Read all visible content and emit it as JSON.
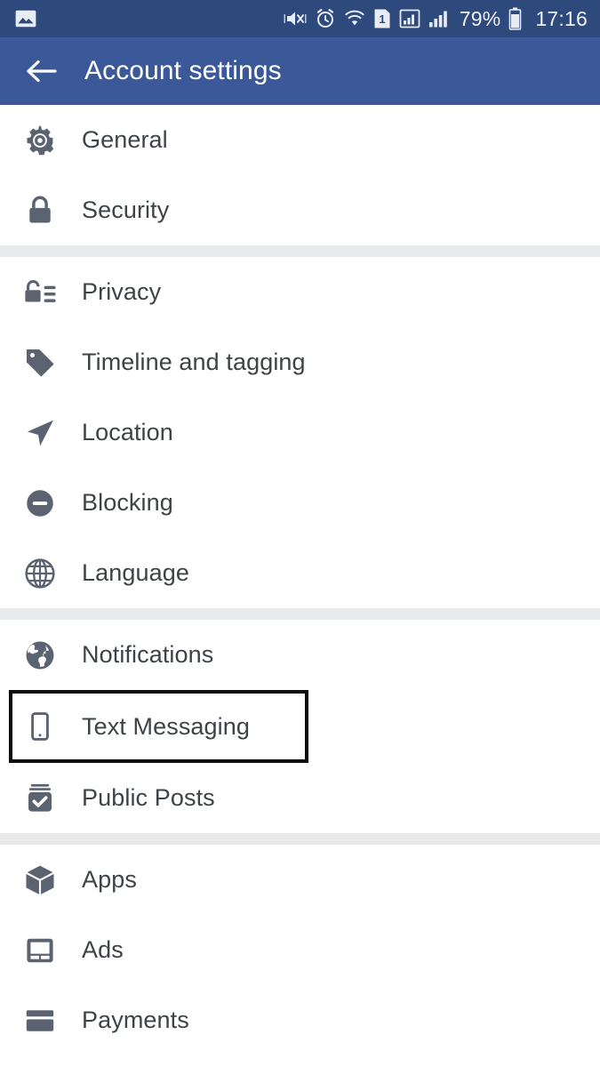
{
  "statusbar": {
    "left_icon": "image-thumbnail-icon",
    "icons": [
      "mute-vibrate-icon",
      "alarm-icon",
      "wifi-icon",
      "sim-1-icon",
      "signal-sim1-icon",
      "signal-sim2-icon"
    ],
    "battery_percent": "79%",
    "battery_icon": "battery-icon",
    "time": "17:16",
    "background_color": "#2e4a7d"
  },
  "appbar": {
    "back_icon": "back-arrow-icon",
    "title": "Account settings",
    "background_color": "#3b5998",
    "text_color": "#ffffff"
  },
  "sections": [
    {
      "items": [
        {
          "label": "General",
          "icon": "gear-icon"
        },
        {
          "label": "Security",
          "icon": "lock-icon"
        }
      ]
    },
    {
      "items": [
        {
          "label": "Privacy",
          "icon": "privacy-lock-list-icon"
        },
        {
          "label": "Timeline and tagging",
          "icon": "tag-icon"
        },
        {
          "label": "Location",
          "icon": "navigation-arrow-icon"
        },
        {
          "label": "Blocking",
          "icon": "minus-circle-icon"
        },
        {
          "label": "Language",
          "icon": "globe-outline-icon"
        }
      ]
    },
    {
      "items": [
        {
          "label": "Notifications",
          "icon": "globe-filled-icon",
          "highlighted": false
        },
        {
          "label": "Text Messaging",
          "icon": "mobile-phone-icon",
          "highlighted": true
        },
        {
          "label": "Public Posts",
          "icon": "stack-check-icon",
          "highlighted": false
        }
      ]
    },
    {
      "items": [
        {
          "label": "Apps",
          "icon": "cube-icon"
        },
        {
          "label": "Ads",
          "icon": "ads-window-icon"
        },
        {
          "label": "Payments",
          "icon": "credit-card-icon"
        }
      ]
    }
  ],
  "colors": {
    "icon_gray": "#5b6270",
    "label_gray": "#3e4348",
    "divider_gray": "#e7e9eb",
    "highlight_border": "#0d0d0d",
    "facebook_blue": "#3b5998"
  }
}
